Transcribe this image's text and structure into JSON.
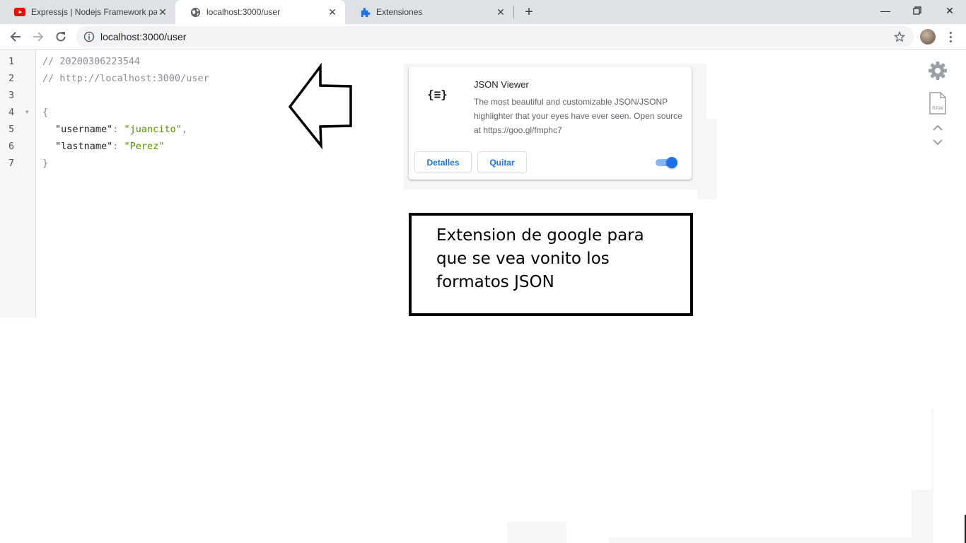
{
  "browser": {
    "tabs": [
      {
        "title": "Expressjs | Nodejs Framework pa",
        "icon": "youtube-icon",
        "active": false
      },
      {
        "title": "localhost:3000/user",
        "icon": "globe-icon",
        "active": true
      },
      {
        "title": "Extensiones",
        "icon": "puzzle-icon",
        "active": false
      }
    ],
    "new_tab": "+",
    "window": {
      "minimize": "—",
      "close": "✕"
    },
    "address": {
      "url": "localhost:3000/user"
    }
  },
  "viewer": {
    "lines": [
      {
        "n": "1",
        "comment": "// 20200306223544"
      },
      {
        "n": "2",
        "comment": "// http://localhost:3000/user"
      },
      {
        "n": "3"
      },
      {
        "n": "4",
        "open": "{"
      },
      {
        "n": "5",
        "key": "\"username\"",
        "sep": ": ",
        "value": "\"juancito\"",
        "comma": ","
      },
      {
        "n": "6",
        "key": "\"lastname\"",
        "sep": ": ",
        "value": "\"Perez\""
      },
      {
        "n": "7",
        "close": "}"
      }
    ],
    "fold_marker": "▼",
    "tools": {
      "raw_label": "RAW"
    }
  },
  "extension": {
    "logo": "{≡}",
    "name": "JSON Viewer",
    "description": "The most beautiful and customizable JSON/JSONP highlighter that your eyes have ever seen. Open source at https://goo.gl/fmphc7",
    "details_label": "Detalles",
    "remove_label": "Quitar",
    "enabled": true
  },
  "annotation": {
    "text": "Extension de google para que se vea vonito los formatos JSON"
  }
}
